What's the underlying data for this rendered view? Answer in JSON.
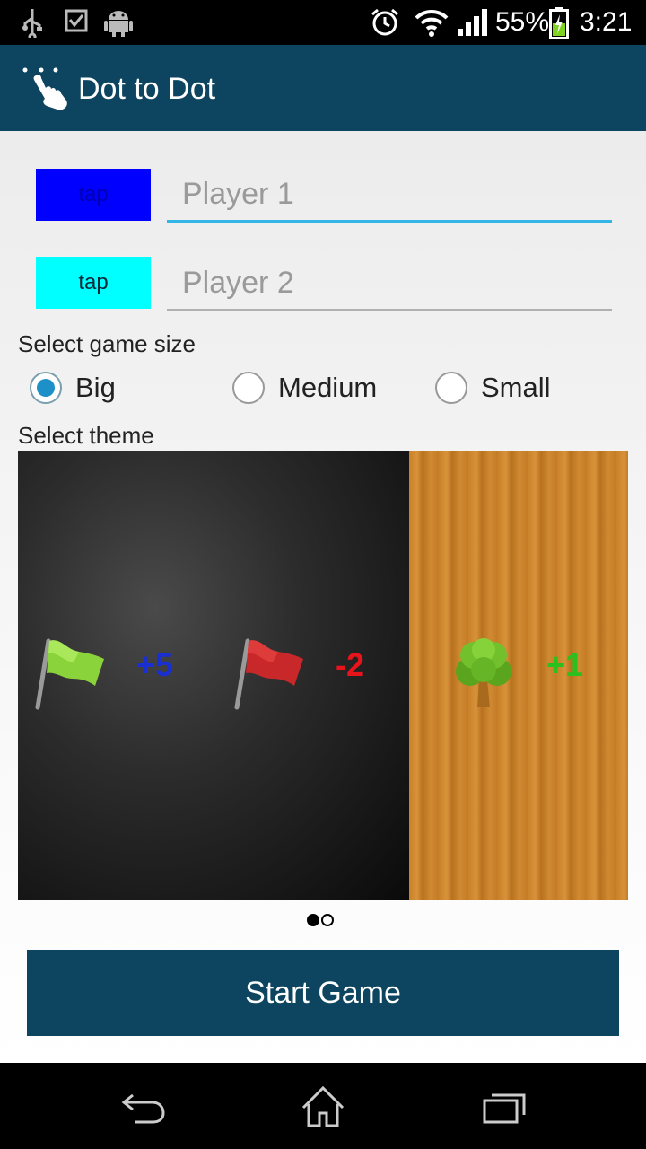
{
  "status_bar": {
    "battery_percent": "55%",
    "time": "3:21",
    "left_icons": [
      "usb-icon",
      "checkbox-icon",
      "android-icon"
    ],
    "right_icons": [
      "alarm-icon",
      "wifi-icon",
      "signal-icon",
      "battery-icon"
    ]
  },
  "app_bar": {
    "title": "Dot to Dot",
    "icon": "tap-hand-icon",
    "color": "#0d4560"
  },
  "players": [
    {
      "button_label": "tap",
      "color": "#0000ff",
      "placeholder": "Player 1",
      "value": ""
    },
    {
      "button_label": "tap",
      "color": "#00ffff",
      "placeholder": "Player 2",
      "value": ""
    }
  ],
  "game_size": {
    "label": "Select game size",
    "options": [
      "Big",
      "Medium",
      "Small"
    ],
    "selected": "Big"
  },
  "theme": {
    "label": "Select theme",
    "items": [
      {
        "name": "dark",
        "badges": [
          "+5",
          "-2"
        ],
        "icons": [
          "green-flag-icon",
          "red-flag-icon"
        ]
      },
      {
        "name": "wood",
        "badges": [
          "+1"
        ],
        "icons": [
          "tree-icon"
        ]
      }
    ],
    "page_count": 2,
    "active_page": 1
  },
  "start_button": {
    "label": "Start Game"
  },
  "nav_bar": {
    "buttons": [
      "back-icon",
      "home-icon",
      "recents-icon"
    ]
  }
}
